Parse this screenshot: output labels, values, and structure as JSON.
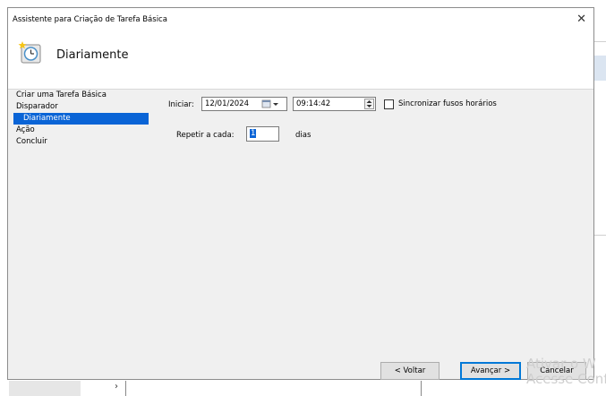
{
  "window": {
    "title": "Assistente para Criação de Tarefa Básica",
    "close_glyph": "✕"
  },
  "header": {
    "title": "Diariamente",
    "icon": "clock-icon"
  },
  "nav": {
    "items": [
      {
        "label": "Criar uma Tarefa Básica",
        "selected": false,
        "sub": false
      },
      {
        "label": "Disparador",
        "selected": false,
        "sub": false
      },
      {
        "label": "Diariamente",
        "selected": true,
        "sub": true
      },
      {
        "label": "Ação",
        "selected": false,
        "sub": false
      },
      {
        "label": "Concluir",
        "selected": false,
        "sub": false
      }
    ]
  },
  "form": {
    "start_label": "Iniciar:",
    "date_value": "12/01/2024",
    "time_value": "09:14:42",
    "sync_label": "Sincronizar fusos horários",
    "sync_checked": false,
    "repeat_label": "Repetir a cada:",
    "repeat_value": "1",
    "days_label": "dias"
  },
  "buttons": {
    "back": "< Voltar",
    "next": "Avançar >",
    "cancel": "Cancelar"
  },
  "watermark": {
    "line1": "Ativar o W",
    "line2": "Acesse Conf"
  },
  "colors": {
    "selection": "#0a64d6",
    "dialog_bg": "#f0f0f0",
    "accent_border": "#0078d7"
  }
}
